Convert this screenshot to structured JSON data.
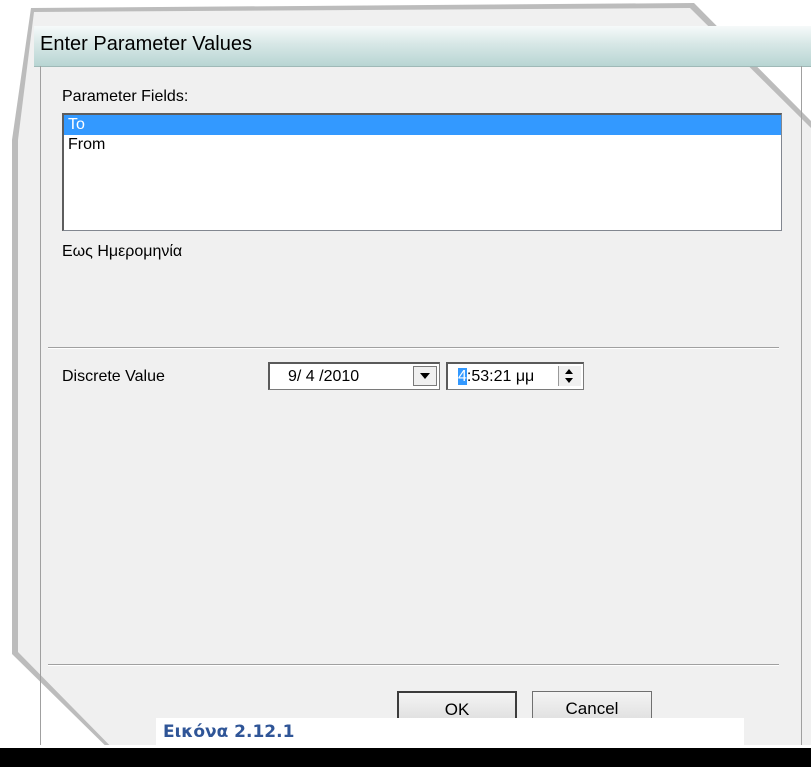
{
  "window": {
    "title": "Enter Parameter Values"
  },
  "parameter_fields": {
    "label": "Parameter Fields:",
    "items": [
      {
        "label": "To",
        "selected": true
      },
      {
        "label": "From",
        "selected": false
      }
    ]
  },
  "description": "Εως Ημερομηνία",
  "discrete_value": {
    "label": "Discrete Value",
    "date": "9/ 4 /2010",
    "time_hour": "4",
    "time_rest": ":53:21 μμ"
  },
  "buttons": {
    "ok": "OK",
    "cancel": "Cancel"
  },
  "caption": "Εικόνα 2.12.1",
  "colors": {
    "selection": "#3399ff",
    "caption": "#2f5597"
  }
}
